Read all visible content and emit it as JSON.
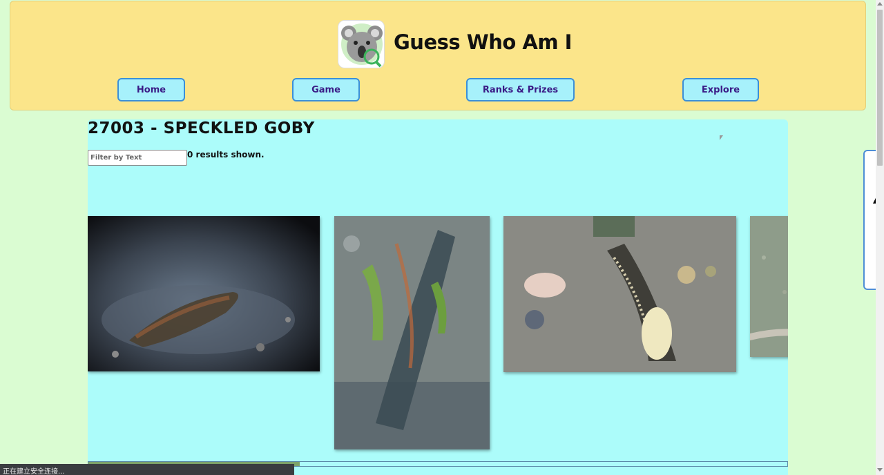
{
  "header": {
    "app_title": "Guess Who Am I",
    "nav": [
      {
        "label": "Home"
      },
      {
        "label": "Game"
      },
      {
        "label": "Ranks & Prizes"
      },
      {
        "label": "Explore"
      }
    ]
  },
  "main": {
    "title": "27003 - SPECKLED GOBY",
    "filter": {
      "placeholder": "Filter by Text",
      "value": ""
    },
    "results_text": "0 results shown."
  },
  "status_bar": {
    "text": "正在建立安全连接..."
  },
  "colors": {
    "page_bg": "#dafcd2",
    "header_bg": "#fbe58a",
    "content_bg": "#acfcfa",
    "nav_button_bg": "#a7f1fb",
    "nav_button_border": "#3b8fd8",
    "nav_text": "#3a1b86"
  },
  "icons": {
    "logo": "koala-magnifier-logo-icon",
    "side_panel": "side-drawer-icon"
  }
}
